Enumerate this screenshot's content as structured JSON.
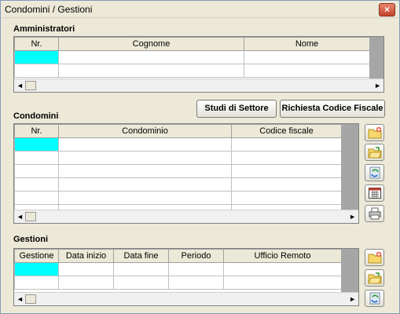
{
  "window": {
    "title": "Condomini / Gestioni",
    "close_label": "×"
  },
  "amministratori": {
    "label": "Amministratori",
    "columns": [
      "Nr.",
      "Cognome",
      "Nome"
    ]
  },
  "buttons": {
    "studi": "Studi di Settore",
    "richiesta": "Richiesta Codice Fiscale"
  },
  "condomini": {
    "label": "Condomini",
    "columns": [
      "Nr.",
      "Condominio",
      "Codice fiscale"
    ]
  },
  "gestioni": {
    "label": "Gestioni",
    "columns": [
      "Gestione",
      "Data inizio",
      "Data fine",
      "Periodo",
      "Ufficio Remoto"
    ]
  },
  "icons": {
    "condomini": [
      "folder-new-icon",
      "folder-open-icon",
      "refresh-icon",
      "calendar-icon",
      "printer-icon"
    ],
    "gestioni": [
      "folder-new-icon",
      "folder-open-icon",
      "refresh-icon"
    ]
  },
  "colors": {
    "selected_cell": "#00ffff"
  }
}
